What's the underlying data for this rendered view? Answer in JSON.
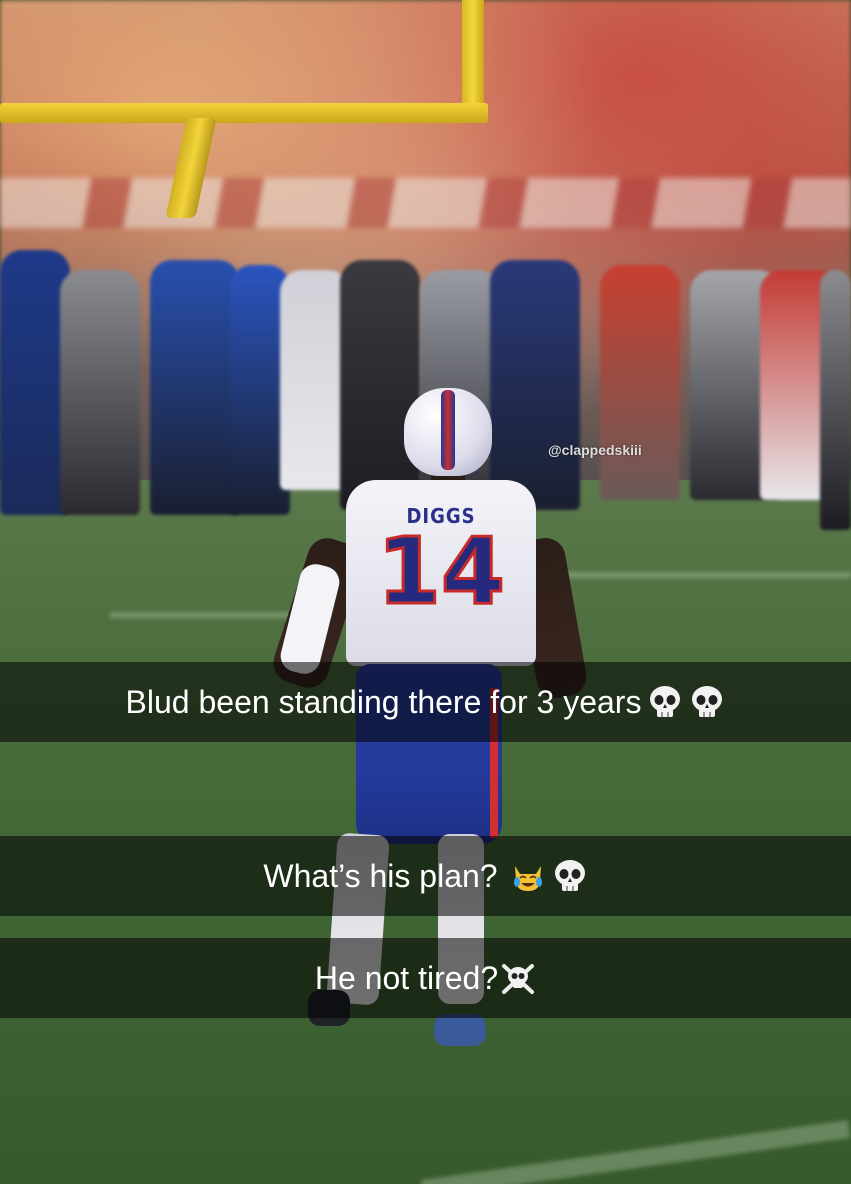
{
  "photo": {
    "player_name": "DIGGS",
    "player_number": "14",
    "watermark": "@clappedskiii"
  },
  "captions": [
    {
      "text": "Blud been standing there for 3 years",
      "emojis": [
        "skull-icon",
        "skull-icon"
      ]
    },
    {
      "text": "What’s his plan?",
      "emojis": [
        "cat-tears-of-joy-icon",
        "skull-icon"
      ]
    },
    {
      "text": "He not tired?",
      "emojis": [
        "skull-crossbones-icon"
      ]
    }
  ]
}
